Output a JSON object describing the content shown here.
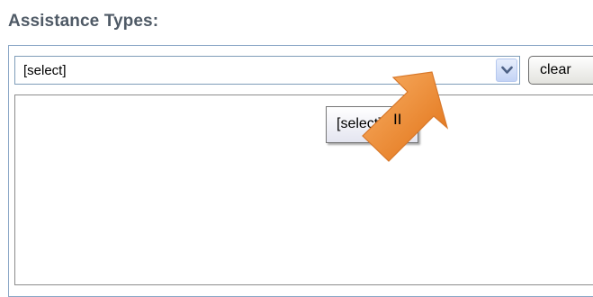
{
  "heading": "Assistance Types:",
  "select": {
    "value": "[select]",
    "arrow_icon": "chevron-down-icon"
  },
  "clear_label": "clear",
  "tooltip_text": "[select]",
  "cursor": {
    "icon": "arrow-cursor-icon",
    "label": "II",
    "color": "#f08a2c"
  },
  "colors": {
    "heading": "#4f5a66",
    "panel_border": "#8aa6c6",
    "select_border": "#7f9db9",
    "arrow_bg": "#c3d3f5",
    "arrow_glyph": "#4d6185"
  }
}
